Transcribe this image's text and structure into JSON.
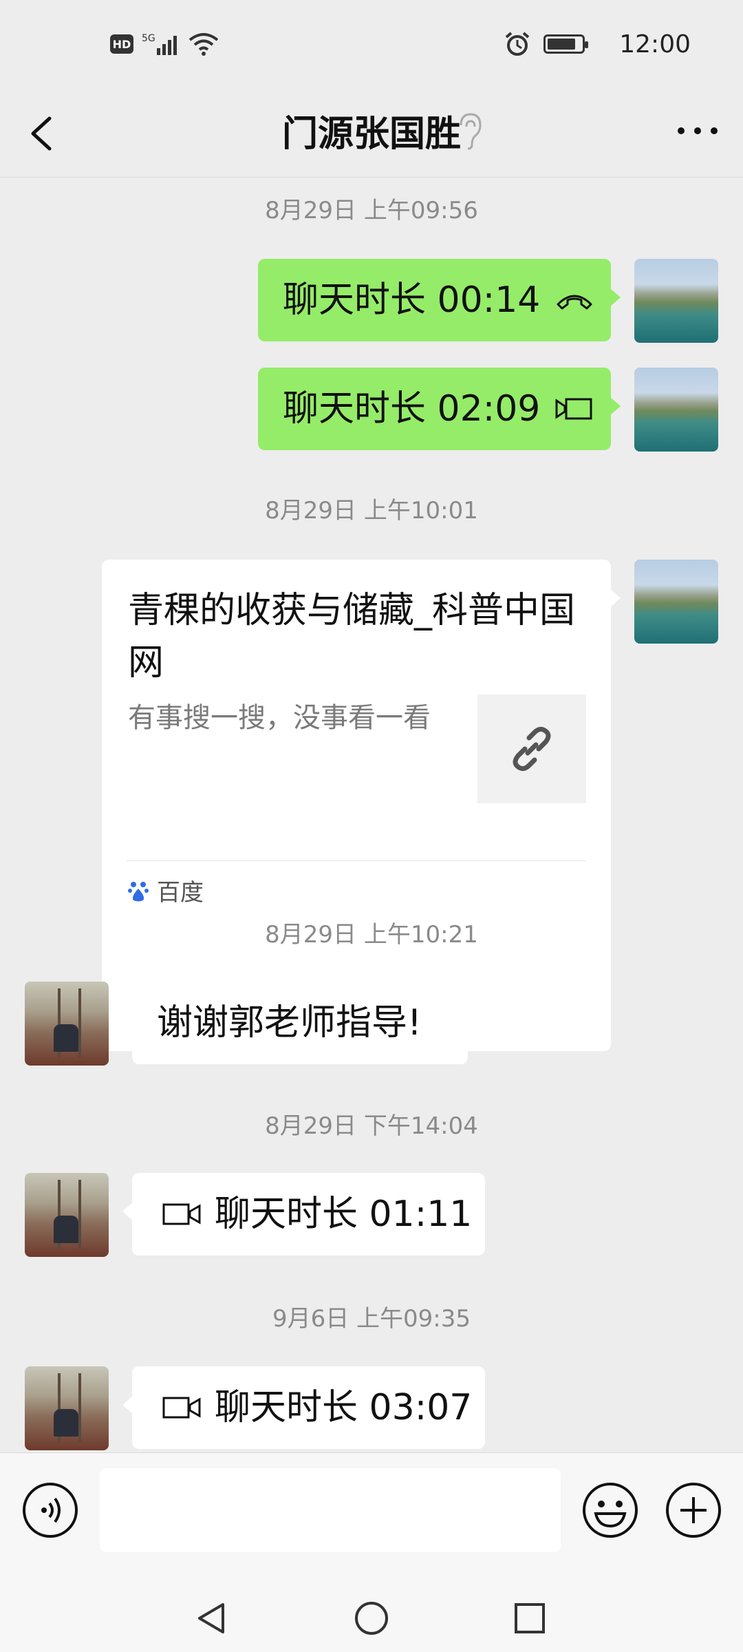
{
  "status_bar": {
    "hd_label": "HD",
    "network_label": "5G",
    "time": "12:00"
  },
  "nav": {
    "title": "门源张国胜"
  },
  "messages": {
    "ts1": "8月29日 上午09:56",
    "m1_text": "聊天时长 00:14",
    "m2_text": "聊天时长 02:09",
    "ts2": "8月29日 上午10:01",
    "link": {
      "title": "青稞的收获与储藏_科普中国网",
      "description": "有事搜一搜，没事看一看",
      "source": "百度"
    },
    "ts3": "8月29日 上午10:21",
    "m4_text": "谢谢郭老师指导!",
    "ts4": "8月29日 下午14:04",
    "m5_text": "聊天时长 01:11",
    "ts5": "9月6日 上午09:35",
    "m6_text": "聊天时长 03:07"
  },
  "colors": {
    "sent_bubble": "#95ec69",
    "received_bubble": "#ffffff",
    "background": "#ededed"
  }
}
